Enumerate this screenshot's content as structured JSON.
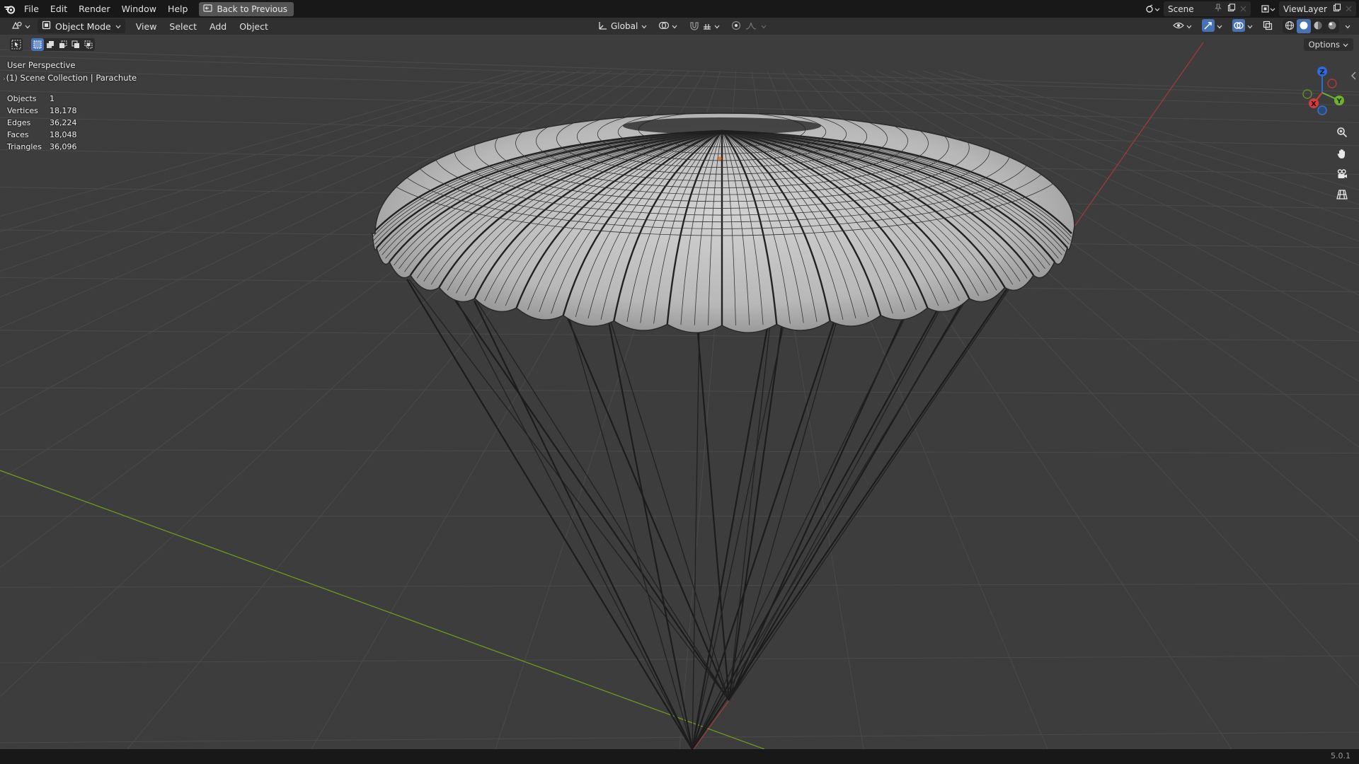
{
  "topbar": {
    "menus": [
      "File",
      "Edit",
      "Render",
      "Window",
      "Help"
    ],
    "back_label": "Back to Previous",
    "scene_name": "Scene",
    "view_layer_name": "ViewLayer"
  },
  "header": {
    "mode_label": "Object Mode",
    "menus": [
      "View",
      "Select",
      "Add",
      "Object"
    ],
    "transform_orientation": "Global"
  },
  "toolrow": {
    "options_label": "Options"
  },
  "viewport": {
    "view_name": "User Perspective",
    "collection_path": "(1) Scene Collection | Parachute",
    "stats": [
      {
        "label": "Objects",
        "value": "1"
      },
      {
        "label": "Vertices",
        "value": "18,178"
      },
      {
        "label": "Edges",
        "value": "36,224"
      },
      {
        "label": "Faces",
        "value": "18,048"
      },
      {
        "label": "Triangles",
        "value": "36,096"
      }
    ],
    "gizmo_axes": {
      "x": "X",
      "y": "Y",
      "z": "Z"
    },
    "colors": {
      "background": "#3d3d3d",
      "grid": "#4a4a4a",
      "x_axis": "#a23b3b",
      "y_axis": "#6b9a1e",
      "canopy": "#bdbdbd",
      "wire": "#2a2a2a"
    }
  },
  "statusbar": {
    "version": "5.0.1"
  }
}
